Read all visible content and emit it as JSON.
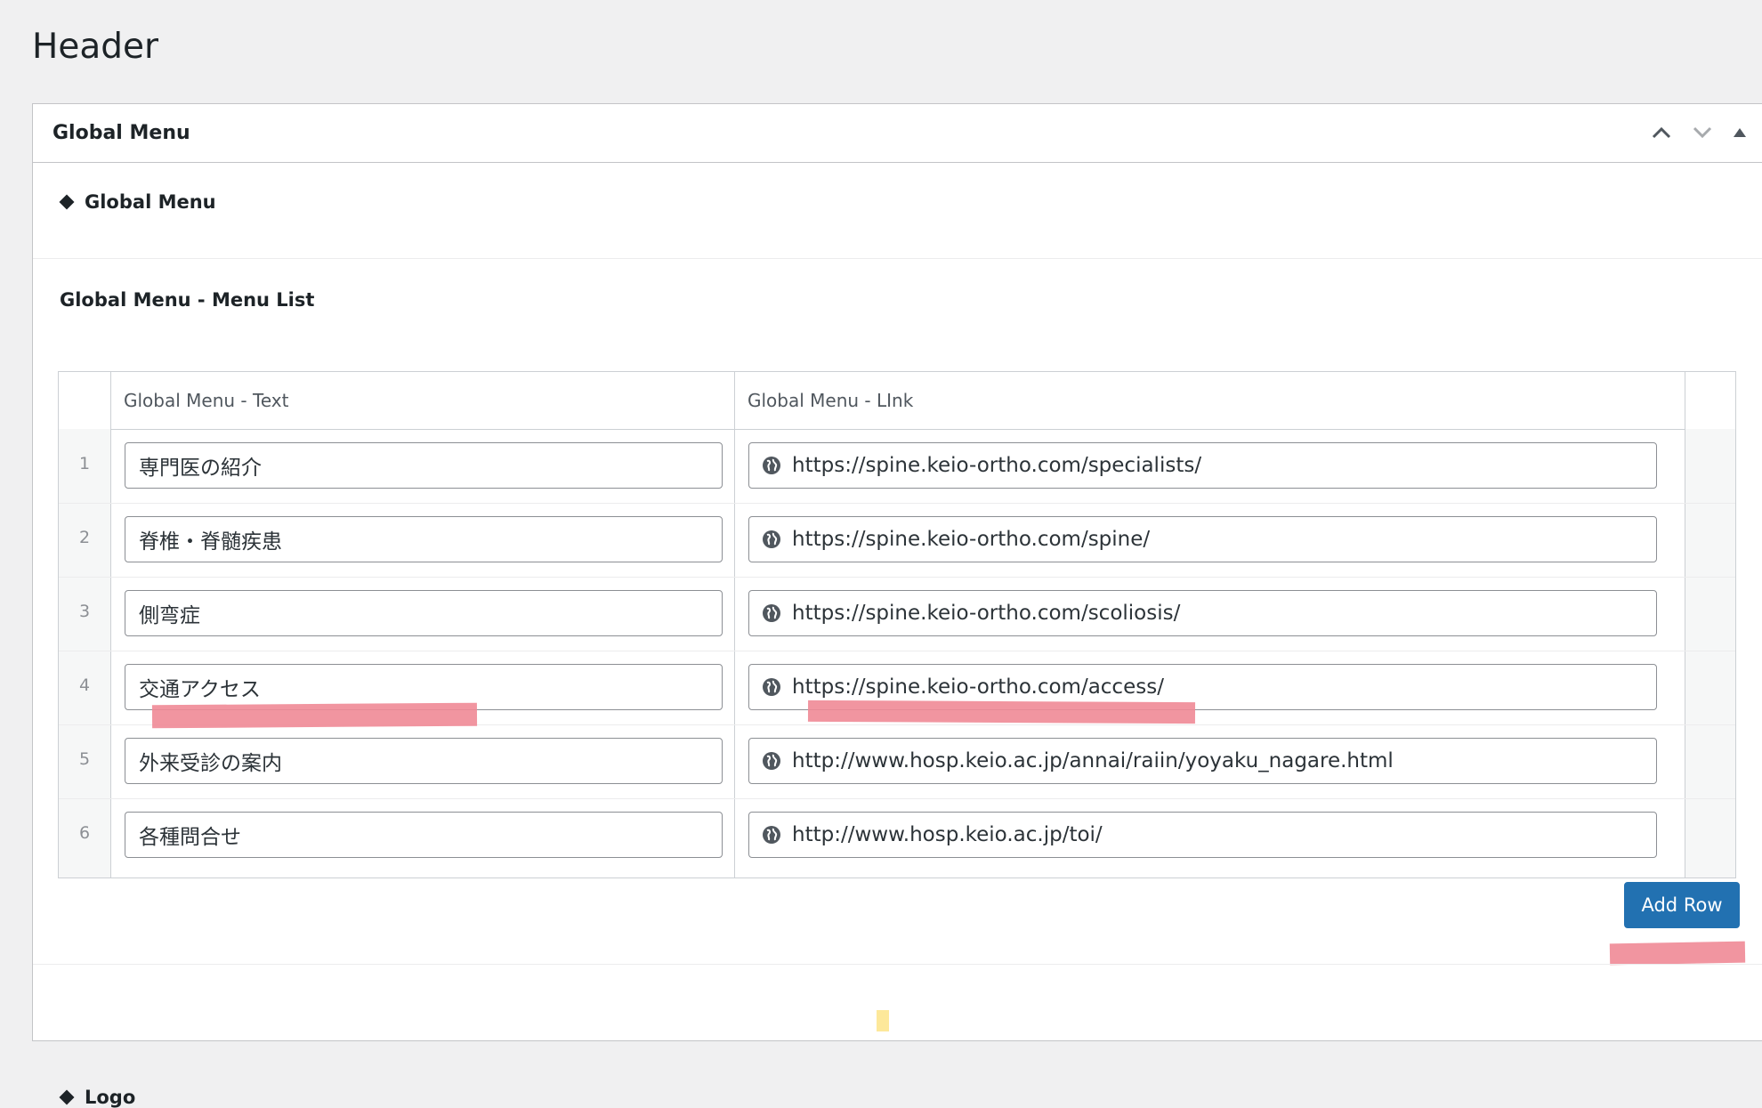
{
  "page": {
    "title": "Header"
  },
  "postbox": {
    "title": "Global Menu",
    "handles": {
      "up": "chevron-up-icon",
      "down": "chevron-down-icon",
      "toggle": "triangle-up-icon"
    }
  },
  "sections": {
    "global_menu": "Global Menu",
    "logo": "Logo"
  },
  "repeater": {
    "label": "Global Menu - Menu List",
    "columns": {
      "text": "Global Menu - Text",
      "link": "Global Menu - LInk"
    },
    "rows": [
      {
        "num": "1",
        "text": "専門医の紹介",
        "link": "https://spine.keio-ortho.com/specialists/"
      },
      {
        "num": "2",
        "text": "脊椎・脊髄疾患",
        "link": "https://spine.keio-ortho.com/spine/"
      },
      {
        "num": "3",
        "text": "側弯症",
        "link": "https://spine.keio-ortho.com/scoliosis/"
      },
      {
        "num": "4",
        "text": "交通アクセス",
        "link": "https://spine.keio-ortho.com/access/"
      },
      {
        "num": "5",
        "text": "外来受診の案内",
        "link": "http://www.hosp.keio.ac.jp/annai/raiin/yoyaku_nagare.html"
      },
      {
        "num": "6",
        "text": "各種問合せ",
        "link": "http://www.hosp.keio.ac.jp/toi/"
      }
    ],
    "add_row_label": "Add Row"
  },
  "colors": {
    "primary": "#2271b1",
    "highlight": "#f08a96"
  }
}
